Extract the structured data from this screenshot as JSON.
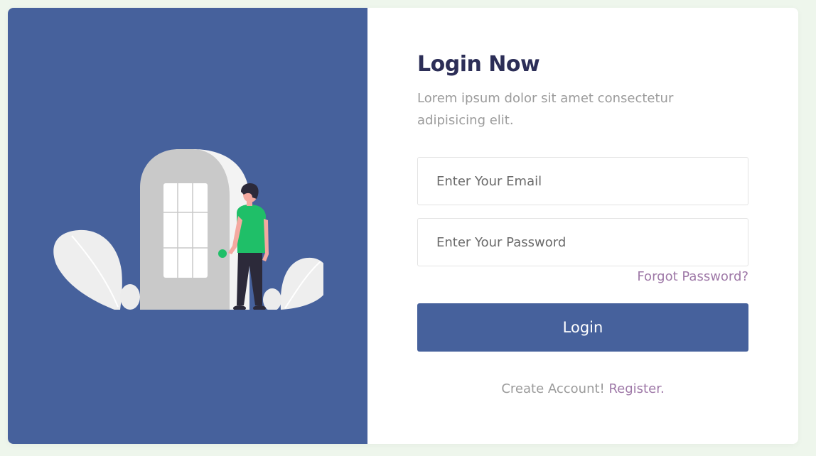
{
  "login": {
    "title": "Login Now",
    "subtitle": "Lorem ipsum dolor sit amet consectetur adipisicing elit.",
    "email_placeholder": "Enter Your Email",
    "password_placeholder": "Enter Your Password",
    "forgot_password": "Forgot Password?",
    "login_button": "Login",
    "create_account_text": "Create Account!",
    "register_link": "Register."
  },
  "colors": {
    "page_background": "#eef6ec",
    "panel_blue": "#46619c",
    "title_color": "#2c2e57",
    "muted_text": "#9b9b9b",
    "link_purple": "#9e78a7",
    "shirt_green": "#1fbf68"
  },
  "illustration": {
    "icon": "person-at-door-illustration"
  }
}
